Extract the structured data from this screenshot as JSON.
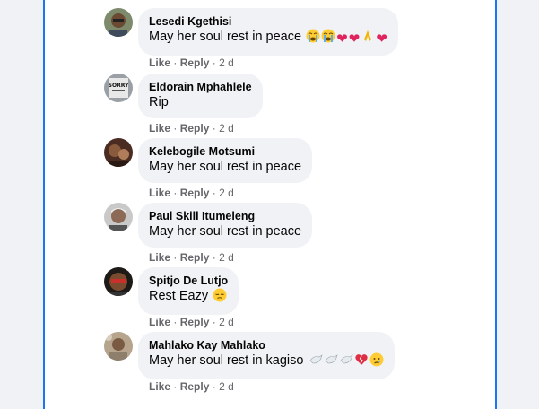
{
  "comments": [
    {
      "name": "Lesedi Kgethisi",
      "text": "May her soul rest in peace",
      "like": "Like",
      "reply": "Reply",
      "time": "2 d",
      "sep1": "·",
      "sep2": "·"
    },
    {
      "name": "Eldorain Mphahlele",
      "text": "Rip",
      "like": "Like",
      "reply": "Reply",
      "time": "2 d",
      "sep1": "·",
      "sep2": "·",
      "avatar_text": "SORRY"
    },
    {
      "name": "Kelebogile Motsumi",
      "text": "May her soul rest in peace",
      "like": "Like",
      "reply": "Reply",
      "time": "2 d",
      "sep1": "·",
      "sep2": "·"
    },
    {
      "name": "Paul Skill Itumeleng",
      "text": "May her soul rest in peace",
      "like": "Like",
      "reply": "Reply",
      "time": "2 d",
      "sep1": "·",
      "sep2": "·"
    },
    {
      "name": "Spitjo De Lutjo",
      "text": "Rest Eazy",
      "like": "Like",
      "reply": "Reply",
      "time": "2 d",
      "sep1": "·",
      "sep2": "·"
    },
    {
      "name": "Mahlako Kay Mahlako",
      "text": "May her soul rest in kagiso",
      "like": "Like",
      "reply": "Reply",
      "time": "2 d",
      "sep1": "·",
      "sep2": "·"
    }
  ],
  "emoji": {
    "c0": [
      "loudly-crying-face-icon",
      "loudly-crying-face-icon",
      "red-heart-icon",
      "red-heart-icon",
      "folded-hands-icon",
      "red-heart-icon"
    ],
    "c4": [
      "pensive-face-icon"
    ],
    "c5": [
      "dove-icon",
      "dove-icon",
      "dove-icon",
      "broken-heart-icon",
      "crying-face-icon"
    ]
  },
  "colors": {
    "accent_border": "#1877f2",
    "bubble": "#f0f2f5",
    "meta_text": "#65676b",
    "name_text": "#050505"
  }
}
